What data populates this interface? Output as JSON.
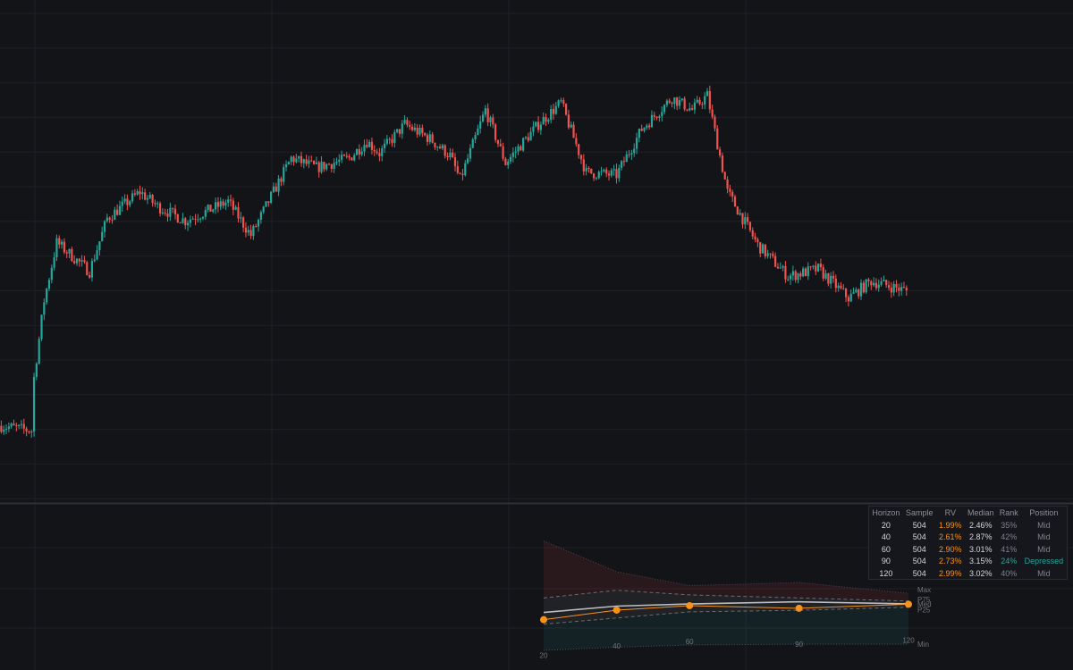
{
  "colors": {
    "background": "#131418",
    "grid": "#1e2026",
    "up": "#26a69a",
    "down": "#ef5350",
    "rv": "#f7931a",
    "median": "#b9bcc2"
  },
  "chart_data": [
    {
      "type": "candlestick",
      "count": 360,
      "seed": 7,
      "anchors": [
        [
          0,
          0.145
        ],
        [
          12,
          0.135
        ],
        [
          13,
          0.245
        ],
        [
          17,
          0.405
        ],
        [
          22,
          0.525
        ],
        [
          35,
          0.465
        ],
        [
          42,
          0.575
        ],
        [
          55,
          0.63
        ],
        [
          62,
          0.6
        ],
        [
          73,
          0.57
        ],
        [
          90,
          0.61
        ],
        [
          99,
          0.54
        ],
        [
          106,
          0.61
        ],
        [
          115,
          0.7
        ],
        [
          125,
          0.68
        ],
        [
          138,
          0.7
        ],
        [
          145,
          0.735
        ],
        [
          150,
          0.71
        ],
        [
          160,
          0.77
        ],
        [
          170,
          0.74
        ],
        [
          178,
          0.705
        ],
        [
          182,
          0.655
        ],
        [
          192,
          0.8
        ],
        [
          200,
          0.69
        ],
        [
          213,
          0.77
        ],
        [
          222,
          0.815
        ],
        [
          232,
          0.67
        ],
        [
          244,
          0.665
        ],
        [
          254,
          0.76
        ],
        [
          266,
          0.825
        ],
        [
          274,
          0.8
        ],
        [
          280,
          0.83
        ],
        [
          288,
          0.63
        ],
        [
          300,
          0.52
        ],
        [
          312,
          0.455
        ],
        [
          324,
          0.47
        ],
        [
          336,
          0.41
        ],
        [
          345,
          0.445
        ],
        [
          359,
          0.425
        ]
      ]
    },
    {
      "type": "area",
      "x": [
        20,
        40,
        60,
        90,
        120
      ],
      "series": [
        {
          "name": "Max",
          "values": [
            7.1,
            5.1,
            4.2,
            4.4,
            3.7
          ]
        },
        {
          "name": "P75",
          "values": [
            3.4,
            3.9,
            3.6,
            3.4,
            3.2
          ]
        },
        {
          "name": "Med",
          "values": [
            2.46,
            2.87,
            3.01,
            3.15,
            3.02
          ]
        },
        {
          "name": "P25",
          "values": [
            1.7,
            2.1,
            2.5,
            2.6,
            2.8
          ]
        },
        {
          "name": "Min",
          "values": [
            0.0,
            0.2,
            0.35,
            0.4,
            0.4
          ]
        },
        {
          "name": "RV",
          "values": [
            1.99,
            2.61,
            2.9,
            2.73,
            2.99
          ]
        }
      ],
      "ylim": [
        0,
        8
      ],
      "band_labels": [
        "Max",
        "P75",
        "Med",
        "P25",
        "Min"
      ],
      "x_ticks": [
        "20",
        "40",
        "60",
        "90",
        "120"
      ]
    }
  ],
  "table": {
    "headers": [
      "Horizon",
      "Sample",
      "RV",
      "Median",
      "Rank",
      "Position"
    ],
    "rows": [
      [
        "20",
        "504",
        "1.99%",
        "2.46%",
        "35%",
        "Mid"
      ],
      [
        "40",
        "504",
        "2.61%",
        "2.87%",
        "42%",
        "Mid"
      ],
      [
        "60",
        "504",
        "2.90%",
        "3.01%",
        "41%",
        "Mid"
      ],
      [
        "90",
        "504",
        "2.73%",
        "3.15%",
        "24%",
        "Depressed"
      ],
      [
        "120",
        "504",
        "2.99%",
        "3.02%",
        "40%",
        "Mid"
      ]
    ]
  }
}
